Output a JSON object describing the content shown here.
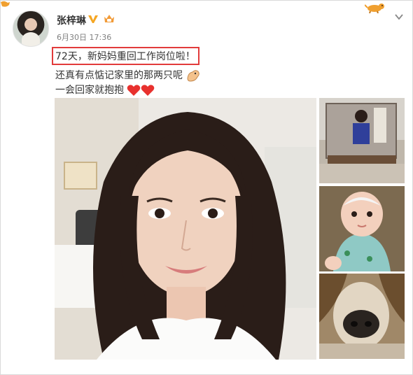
{
  "post": {
    "username": "张梓琳",
    "timestamp": "6月30日 17:36",
    "line1": "72天，新妈妈重回工作岗位啦！",
    "line2": "还真有点惦记家里的那两只呢",
    "line3": "一会回家就抱抱"
  },
  "icons": {
    "verified": "verified-v-icon",
    "member": "member-crown-icon",
    "menu": "chevron-down-icon",
    "decor": "dog-sticker-icon"
  },
  "colors": {
    "highlight_border": "#e23b3b",
    "verified_gold": "#f5a623",
    "heart": "#e8312e"
  }
}
